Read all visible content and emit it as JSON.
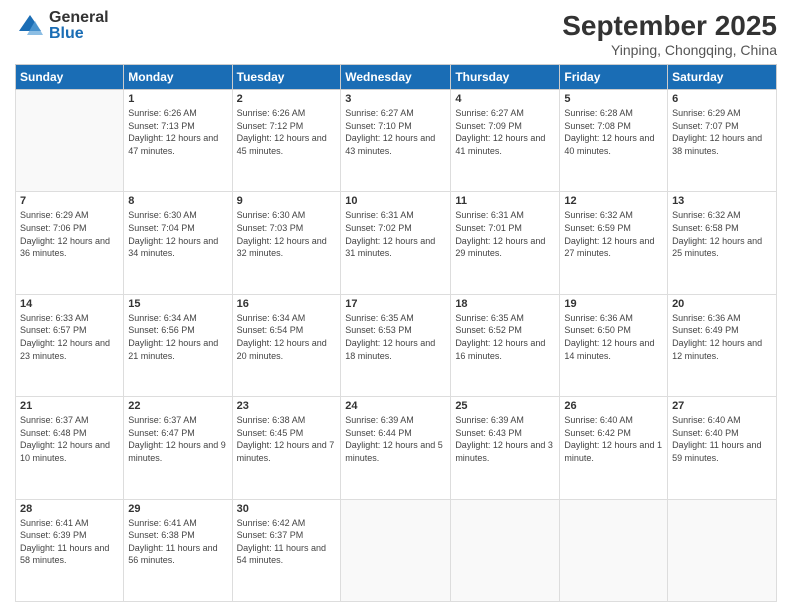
{
  "logo": {
    "general": "General",
    "blue": "Blue"
  },
  "header": {
    "month": "September 2025",
    "location": "Yinping, Chongqing, China"
  },
  "days_of_week": [
    "Sunday",
    "Monday",
    "Tuesday",
    "Wednesday",
    "Thursday",
    "Friday",
    "Saturday"
  ],
  "weeks": [
    [
      {
        "day": "",
        "sunrise": "",
        "sunset": "",
        "daylight": ""
      },
      {
        "day": "1",
        "sunrise": "Sunrise: 6:26 AM",
        "sunset": "Sunset: 7:13 PM",
        "daylight": "Daylight: 12 hours and 47 minutes."
      },
      {
        "day": "2",
        "sunrise": "Sunrise: 6:26 AM",
        "sunset": "Sunset: 7:12 PM",
        "daylight": "Daylight: 12 hours and 45 minutes."
      },
      {
        "day": "3",
        "sunrise": "Sunrise: 6:27 AM",
        "sunset": "Sunset: 7:10 PM",
        "daylight": "Daylight: 12 hours and 43 minutes."
      },
      {
        "day": "4",
        "sunrise": "Sunrise: 6:27 AM",
        "sunset": "Sunset: 7:09 PM",
        "daylight": "Daylight: 12 hours and 41 minutes."
      },
      {
        "day": "5",
        "sunrise": "Sunrise: 6:28 AM",
        "sunset": "Sunset: 7:08 PM",
        "daylight": "Daylight: 12 hours and 40 minutes."
      },
      {
        "day": "6",
        "sunrise": "Sunrise: 6:29 AM",
        "sunset": "Sunset: 7:07 PM",
        "daylight": "Daylight: 12 hours and 38 minutes."
      }
    ],
    [
      {
        "day": "7",
        "sunrise": "Sunrise: 6:29 AM",
        "sunset": "Sunset: 7:06 PM",
        "daylight": "Daylight: 12 hours and 36 minutes."
      },
      {
        "day": "8",
        "sunrise": "Sunrise: 6:30 AM",
        "sunset": "Sunset: 7:04 PM",
        "daylight": "Daylight: 12 hours and 34 minutes."
      },
      {
        "day": "9",
        "sunrise": "Sunrise: 6:30 AM",
        "sunset": "Sunset: 7:03 PM",
        "daylight": "Daylight: 12 hours and 32 minutes."
      },
      {
        "day": "10",
        "sunrise": "Sunrise: 6:31 AM",
        "sunset": "Sunset: 7:02 PM",
        "daylight": "Daylight: 12 hours and 31 minutes."
      },
      {
        "day": "11",
        "sunrise": "Sunrise: 6:31 AM",
        "sunset": "Sunset: 7:01 PM",
        "daylight": "Daylight: 12 hours and 29 minutes."
      },
      {
        "day": "12",
        "sunrise": "Sunrise: 6:32 AM",
        "sunset": "Sunset: 6:59 PM",
        "daylight": "Daylight: 12 hours and 27 minutes."
      },
      {
        "day": "13",
        "sunrise": "Sunrise: 6:32 AM",
        "sunset": "Sunset: 6:58 PM",
        "daylight": "Daylight: 12 hours and 25 minutes."
      }
    ],
    [
      {
        "day": "14",
        "sunrise": "Sunrise: 6:33 AM",
        "sunset": "Sunset: 6:57 PM",
        "daylight": "Daylight: 12 hours and 23 minutes."
      },
      {
        "day": "15",
        "sunrise": "Sunrise: 6:34 AM",
        "sunset": "Sunset: 6:56 PM",
        "daylight": "Daylight: 12 hours and 21 minutes."
      },
      {
        "day": "16",
        "sunrise": "Sunrise: 6:34 AM",
        "sunset": "Sunset: 6:54 PM",
        "daylight": "Daylight: 12 hours and 20 minutes."
      },
      {
        "day": "17",
        "sunrise": "Sunrise: 6:35 AM",
        "sunset": "Sunset: 6:53 PM",
        "daylight": "Daylight: 12 hours and 18 minutes."
      },
      {
        "day": "18",
        "sunrise": "Sunrise: 6:35 AM",
        "sunset": "Sunset: 6:52 PM",
        "daylight": "Daylight: 12 hours and 16 minutes."
      },
      {
        "day": "19",
        "sunrise": "Sunrise: 6:36 AM",
        "sunset": "Sunset: 6:50 PM",
        "daylight": "Daylight: 12 hours and 14 minutes."
      },
      {
        "day": "20",
        "sunrise": "Sunrise: 6:36 AM",
        "sunset": "Sunset: 6:49 PM",
        "daylight": "Daylight: 12 hours and 12 minutes."
      }
    ],
    [
      {
        "day": "21",
        "sunrise": "Sunrise: 6:37 AM",
        "sunset": "Sunset: 6:48 PM",
        "daylight": "Daylight: 12 hours and 10 minutes."
      },
      {
        "day": "22",
        "sunrise": "Sunrise: 6:37 AM",
        "sunset": "Sunset: 6:47 PM",
        "daylight": "Daylight: 12 hours and 9 minutes."
      },
      {
        "day": "23",
        "sunrise": "Sunrise: 6:38 AM",
        "sunset": "Sunset: 6:45 PM",
        "daylight": "Daylight: 12 hours and 7 minutes."
      },
      {
        "day": "24",
        "sunrise": "Sunrise: 6:39 AM",
        "sunset": "Sunset: 6:44 PM",
        "daylight": "Daylight: 12 hours and 5 minutes."
      },
      {
        "day": "25",
        "sunrise": "Sunrise: 6:39 AM",
        "sunset": "Sunset: 6:43 PM",
        "daylight": "Daylight: 12 hours and 3 minutes."
      },
      {
        "day": "26",
        "sunrise": "Sunrise: 6:40 AM",
        "sunset": "Sunset: 6:42 PM",
        "daylight": "Daylight: 12 hours and 1 minute."
      },
      {
        "day": "27",
        "sunrise": "Sunrise: 6:40 AM",
        "sunset": "Sunset: 6:40 PM",
        "daylight": "Daylight: 11 hours and 59 minutes."
      }
    ],
    [
      {
        "day": "28",
        "sunrise": "Sunrise: 6:41 AM",
        "sunset": "Sunset: 6:39 PM",
        "daylight": "Daylight: 11 hours and 58 minutes."
      },
      {
        "day": "29",
        "sunrise": "Sunrise: 6:41 AM",
        "sunset": "Sunset: 6:38 PM",
        "daylight": "Daylight: 11 hours and 56 minutes."
      },
      {
        "day": "30",
        "sunrise": "Sunrise: 6:42 AM",
        "sunset": "Sunset: 6:37 PM",
        "daylight": "Daylight: 11 hours and 54 minutes."
      },
      {
        "day": "",
        "sunrise": "",
        "sunset": "",
        "daylight": ""
      },
      {
        "day": "",
        "sunrise": "",
        "sunset": "",
        "daylight": ""
      },
      {
        "day": "",
        "sunrise": "",
        "sunset": "",
        "daylight": ""
      },
      {
        "day": "",
        "sunrise": "",
        "sunset": "",
        "daylight": ""
      }
    ]
  ]
}
